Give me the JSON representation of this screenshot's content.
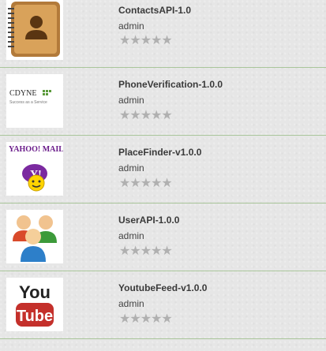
{
  "apis": [
    {
      "name": "ContactsAPI-1.0",
      "owner": "admin",
      "rating": 0,
      "icon": "contacts-book-icon"
    },
    {
      "name": "PhoneVerification-1.0.0",
      "owner": "admin",
      "rating": 0,
      "icon": "cdyne-logo",
      "logo_text": "CDYNE",
      "logo_sub": "Success as a Service"
    },
    {
      "name": "PlaceFinder-v1.0.0",
      "owner": "admin",
      "rating": 0,
      "icon": "yahoo-mail-logo",
      "logo_text": "YAHOO! MAIL"
    },
    {
      "name": "UserAPI-1.0.0",
      "owner": "admin",
      "rating": 0,
      "icon": "users-group-icon"
    },
    {
      "name": "YoutubeFeed-v1.0.0",
      "owner": "admin",
      "rating": 0,
      "icon": "youtube-logo",
      "logo_text_top": "You",
      "logo_text_bottom": "Tube"
    }
  ],
  "star_glyphs": "★★★★★",
  "colors": {
    "star": "#b0b0b0",
    "divider": "#a9c59a",
    "youtube_red": "#c4302b",
    "cdyne_green": "#5a9a3a"
  }
}
